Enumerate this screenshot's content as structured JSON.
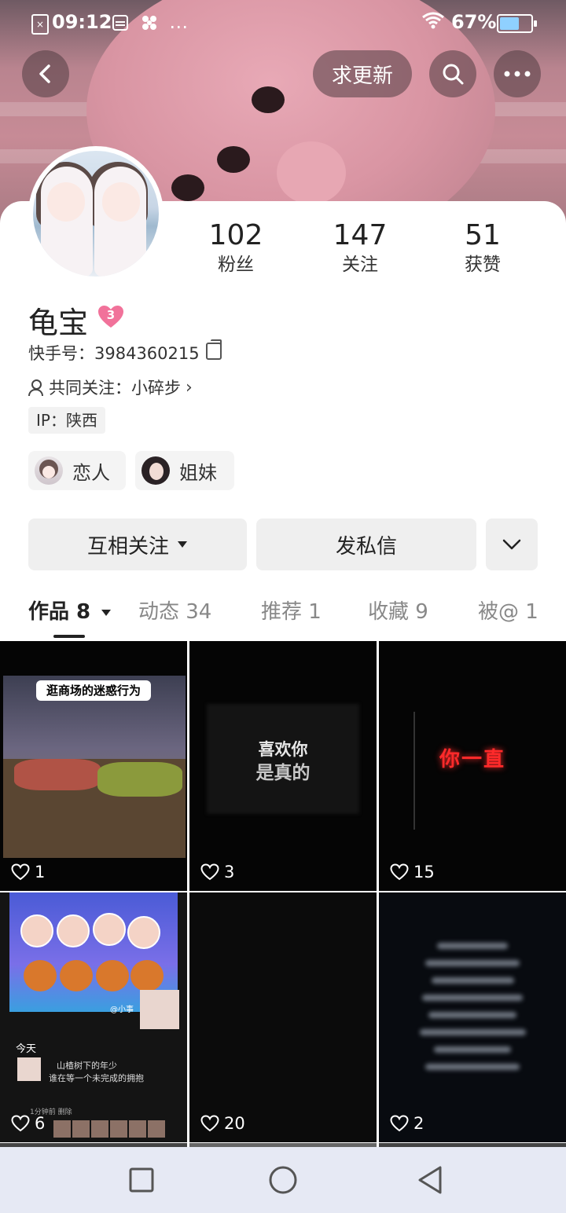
{
  "status_bar": {
    "time": "09:12",
    "battery_percent": "67%",
    "battery_level": 0.67,
    "extra_icons": "…"
  },
  "header": {
    "request_update_label": "求更新",
    "icons": [
      "back-icon",
      "search-icon",
      "more-icon"
    ]
  },
  "profile": {
    "stats": [
      {
        "value": "102",
        "label": "粉丝"
      },
      {
        "value": "147",
        "label": "关注"
      },
      {
        "value": "51",
        "label": "获赞"
      }
    ],
    "name": "龟宝",
    "level_badge": "3",
    "kuaishou_id": "快手号：3984360215",
    "mutual_follow": "共同关注：小碎步",
    "ip": "IP：陕西",
    "relations": [
      {
        "label": "恋人"
      },
      {
        "label": "姐妹"
      }
    ]
  },
  "actions": {
    "follow_label": "互相关注",
    "message_label": "发私信"
  },
  "tabs": [
    {
      "label": "作品 8",
      "active": true
    },
    {
      "label": "动态 34",
      "active": false
    },
    {
      "label": "推荐 1",
      "active": false
    },
    {
      "label": "收藏 9",
      "active": false
    },
    {
      "label": "被@ 1",
      "active": false
    }
  ],
  "works": [
    {
      "likes": "1",
      "overlay": "逛商场的迷惑行为"
    },
    {
      "likes": "3",
      "overlay_line1": "喜欢你",
      "overlay_line2": "是真的"
    },
    {
      "likes": "15",
      "overlay": "你一直"
    },
    {
      "likes": "6",
      "post_today": "今天",
      "post_line1": "山楂树下的年少",
      "post_line2": "谁在等一个未完成的拥抱",
      "post_time": "1分钟前 删除",
      "post_tag": "@小事"
    },
    {
      "likes": "20"
    },
    {
      "likes": "2"
    }
  ],
  "colors": {
    "heart_badge": "#f1729a",
    "neon_red": "#ff2a2a",
    "nav_bg": "#e6e9f4"
  }
}
